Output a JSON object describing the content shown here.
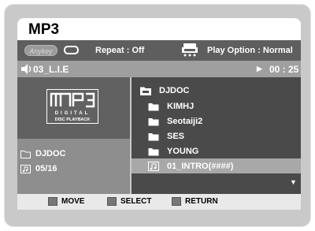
{
  "title": "MP3",
  "options": {
    "anykey_label": "Anykey",
    "repeat_label": "Repeat : Off",
    "play_option_label": "Play Option : Normal"
  },
  "track": {
    "name": "03_L.I.E",
    "time": "00 : 25"
  },
  "info": {
    "folder": "DJDOC",
    "track_count": "05/16"
  },
  "logo": {
    "line1": "DIGITAL",
    "line2": "DISC PLAYBACK"
  },
  "list": {
    "parent": "DJDOC",
    "items": [
      {
        "label": "KIMHJ",
        "type": "folder"
      },
      {
        "label": "Seotaiji2",
        "type": "folder"
      },
      {
        "label": "SES",
        "type": "folder"
      },
      {
        "label": "YOUNG",
        "type": "folder"
      },
      {
        "label": "01_INTRO(####)",
        "type": "music-file"
      }
    ]
  },
  "footer": {
    "move": "MOVE",
    "select": "SELECT",
    "return": "RETURN"
  }
}
